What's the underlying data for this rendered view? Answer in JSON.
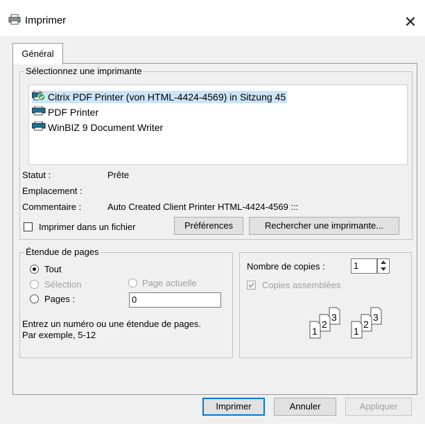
{
  "window": {
    "title": "Imprimer",
    "close_glyph": "✕"
  },
  "tab": {
    "label": "Général"
  },
  "printer_group": {
    "legend": "Sélectionnez une imprimante",
    "printers": [
      {
        "name": "Citrix PDF Printer (von HTML-4424-4569) in Sitzung 45",
        "selected": true,
        "icon": "printer-default-icon"
      },
      {
        "name": "PDF Printer",
        "selected": false,
        "icon": "printer-icon"
      },
      {
        "name": "WinBIZ 9 Document Writer",
        "selected": false,
        "icon": "printer-icon"
      }
    ],
    "status_label": "Statut :",
    "status_value": "Prête",
    "location_label": "Emplacement :",
    "location_value": "",
    "comment_label": "Commentaire :",
    "comment_value": "Auto Created Client Printer HTML-4424-4569 :::",
    "print_to_file_label": "Imprimer dans un fichier",
    "print_to_file_checked": false,
    "preferences_button": "Préférences",
    "find_printer_button": "Rechercher une imprimante..."
  },
  "page_range": {
    "legend": "Étendue de pages",
    "all_label": "Tout",
    "selection_label": "Sélection",
    "current_page_label": "Page actuelle",
    "pages_label": "Pages :",
    "pages_value": "0",
    "selected_option": "all",
    "hint_line1": "Entrez un numéro ou une étendue de pages.",
    "hint_line2": "Par exemple, 5-12"
  },
  "copies": {
    "label": "Nombre de copies :",
    "value": "1",
    "collate_label": "Copies assemblées",
    "collate_checked": true,
    "collate_enabled": false,
    "page_digits": [
      "1",
      "2",
      "3"
    ]
  },
  "footer": {
    "print_button": "Imprimer",
    "cancel_button": "Annuler",
    "apply_button": "Appliquer"
  },
  "colors": {
    "selection": "#cce4f7",
    "accent": "#0078d7",
    "disabled_text": "#a0a0a0",
    "default_badge": "#2a9d3c"
  }
}
